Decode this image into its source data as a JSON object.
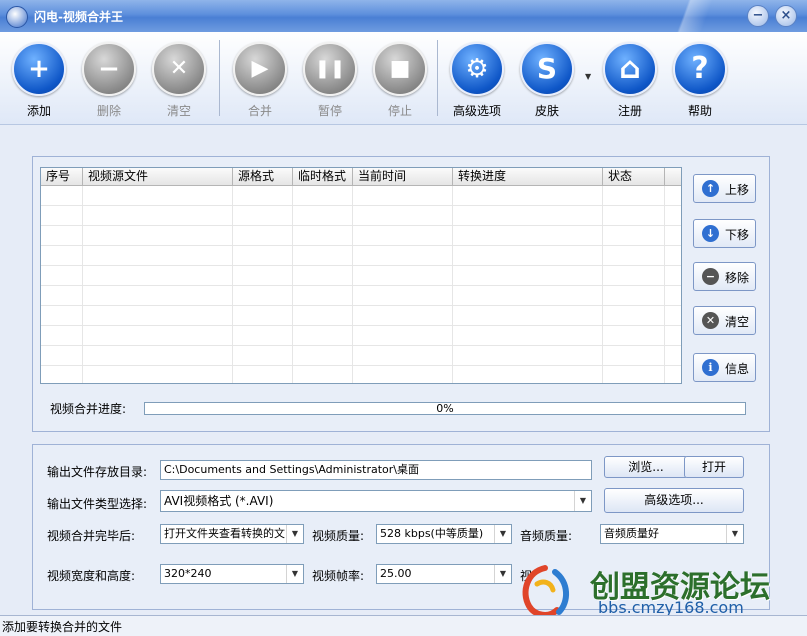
{
  "window": {
    "title": "闪电-视频合并王",
    "minimize": "−",
    "close": "×"
  },
  "toolbar": [
    {
      "label": "添加",
      "glyph": "+",
      "enabled": true,
      "icon": "plus-icon"
    },
    {
      "label": "删除",
      "glyph": "−",
      "enabled": false,
      "icon": "minus-icon"
    },
    {
      "label": "清空",
      "glyph": "✕",
      "enabled": false,
      "icon": "x-icon"
    },
    {
      "label": "合并",
      "glyph": "▶",
      "enabled": false,
      "icon": "play-icon"
    },
    {
      "label": "暂停",
      "glyph": "❚❚",
      "enabled": false,
      "icon": "pause-icon"
    },
    {
      "label": "停止",
      "glyph": "■",
      "enabled": false,
      "icon": "stop-icon"
    },
    {
      "label": "高级选项",
      "glyph": "⚙",
      "enabled": true,
      "icon": "tools-icon"
    },
    {
      "label": "皮肤",
      "glyph": "S",
      "enabled": true,
      "icon": "skin-icon"
    },
    {
      "label": "注册",
      "glyph": "⌂",
      "enabled": true,
      "icon": "home-icon"
    },
    {
      "label": "帮助",
      "glyph": "?",
      "enabled": true,
      "icon": "help-icon"
    }
  ],
  "table": {
    "columns": [
      "序号",
      "视频源文件",
      "源格式",
      "临时格式",
      "当前时间",
      "转换进度",
      "状态"
    ]
  },
  "side_buttons": [
    {
      "label": "上移",
      "glyph": "↑",
      "icon": "up-arrow-icon",
      "color": "#2f6fd1"
    },
    {
      "label": "下移",
      "glyph": "↓",
      "icon": "down-arrow-icon",
      "color": "#2f6fd1"
    },
    {
      "label": "移除",
      "glyph": "−",
      "icon": "minus-icon",
      "color": "#555555"
    },
    {
      "label": "清空",
      "glyph": "✕",
      "icon": "x-icon",
      "color": "#555555"
    },
    {
      "label": "信息",
      "glyph": "i",
      "icon": "info-icon",
      "color": "#2f6fd1"
    }
  ],
  "progress": {
    "label": "视频合并进度:",
    "value": 0,
    "text": "0%"
  },
  "output": {
    "dir_label": "输出文件存放目录:",
    "dir_value": "C:\\Documents and Settings\\Administrator\\桌面",
    "browse": "浏览...",
    "open": "打开",
    "type_label": "输出文件类型选择:",
    "type_value": "AVI视频格式 (*.AVI)",
    "advanced": "高级选项...",
    "after_label": "视频合并完毕后:",
    "after_value": "打开文件夹查看转换的文",
    "vq_label": "视频质量:",
    "vq_value": "528 kbps(中等质量)",
    "aq_label": "音频质量:",
    "aq_value": "音频质量好",
    "size_label": "视频宽度和高度:",
    "size_value": "320*240",
    "fps_label": "视频帧率:",
    "fps_value": "25.00",
    "partial_label": "视"
  },
  "status": "添加要转换合并的文件",
  "watermark": {
    "line1": "创盟资源论坛",
    "line2": "bbs.cmzy168.com"
  }
}
